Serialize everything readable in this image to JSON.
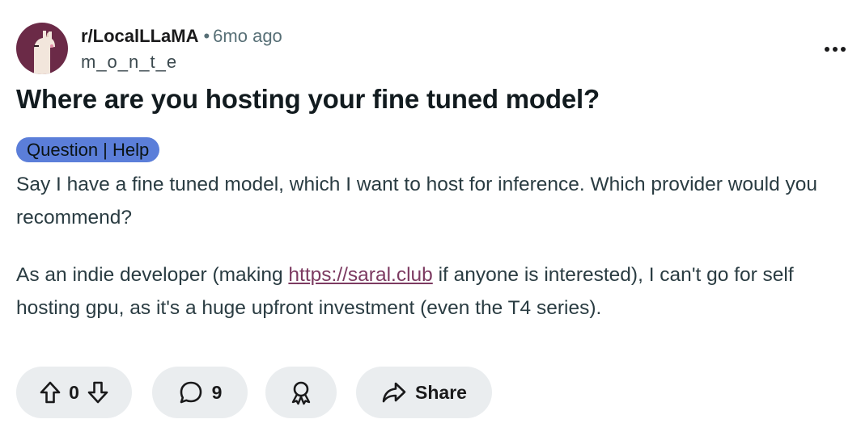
{
  "post": {
    "subreddit": "r/LocalLLaMA",
    "separator": "•",
    "time_ago": "6mo ago",
    "author": "m_o_n_t_e",
    "title": "Where are you hosting your fine tuned model?",
    "flair": "Question | Help",
    "body": {
      "p1": "Say I have a fine tuned model, which I want to host for inference. Which provider would you recommend?",
      "p2_before": "As an indie developer (making ",
      "p2_link": "https://saral.club",
      "p2_after": " if anyone is interested), I can't go for self hosting gpu, as it's a huge upfront investment (even the T4 series)."
    }
  },
  "actions": {
    "vote_count": "0",
    "comment_count": "9",
    "share_label": "Share"
  },
  "icons": {
    "more": "more-horizontal-icon",
    "upvote": "arrow-up-icon",
    "downvote": "arrow-down-icon",
    "comment": "speech-bubble-icon",
    "award": "award-ribbon-icon",
    "share": "share-arrow-icon"
  },
  "colors": {
    "avatar_bg": "#6b2a47",
    "flair_bg": "#5b7ed9",
    "link": "#7c3a61",
    "pill_bg": "#eaedef"
  }
}
